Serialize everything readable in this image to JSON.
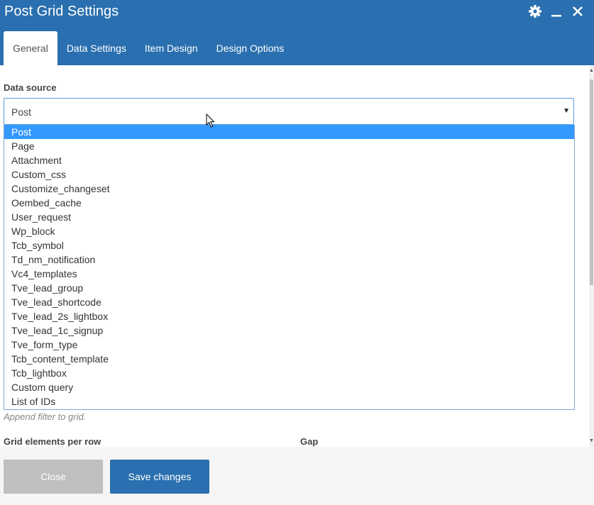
{
  "window": {
    "title": "Post Grid Settings",
    "icons": [
      "gear-icon",
      "minimize-icon",
      "close-icon"
    ]
  },
  "tabs": [
    {
      "label": "General",
      "active": true
    },
    {
      "label": "Data Settings"
    },
    {
      "label": "Item Design"
    },
    {
      "label": "Design Options"
    }
  ],
  "data_source": {
    "label": "Data source",
    "selected": "Post",
    "options": [
      "Post",
      "Page",
      "Attachment",
      "Custom_css",
      "Customize_changeset",
      "Oembed_cache",
      "User_request",
      "Wp_block",
      "Tcb_symbol",
      "Td_nm_notification",
      "Vc4_templates",
      "Tve_lead_group",
      "Tve_lead_shortcode",
      "Tve_lead_2s_lightbox",
      "Tve_lead_1c_signup",
      "Tve_form_type",
      "Tcb_content_template",
      "Tcb_lightbox",
      "Custom query",
      "List of IDs"
    ],
    "hint": "Append filter to grid."
  },
  "grid": {
    "elements_label": "Grid elements per row",
    "gap_label": "Gap"
  },
  "footer": {
    "close_label": "Close",
    "save_label": "Save changes"
  },
  "colors": {
    "header": "#2a6faf",
    "selected_option": "#3399ff",
    "close_button": "#bfbfbf"
  }
}
